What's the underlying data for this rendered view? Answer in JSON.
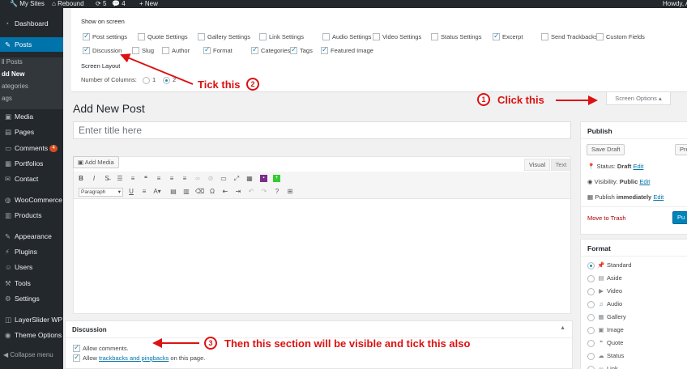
{
  "adminbar": {
    "my_sites": "My Sites",
    "site": "Rebound",
    "updates": "5",
    "comments": "4",
    "new": "New",
    "howdy": "Howdy, A"
  },
  "sidebar": {
    "dashboard": "Dashboard",
    "posts": "Posts",
    "sub": [
      "ll Posts",
      "dd New",
      "ategories",
      "ags"
    ],
    "media": "Media",
    "pages": "Pages",
    "comments": "Comments",
    "comments_badge": "4",
    "portfolios": "Portfolios",
    "contact": "Contact",
    "woocommerce": "WooCommerce",
    "products": "Products",
    "appearance": "Appearance",
    "plugins": "Plugins",
    "users": "Users",
    "tools": "Tools",
    "settings": "Settings",
    "layerslider": "LayerSlider WP",
    "theme_options": "Theme Options",
    "collapse": "Collapse menu"
  },
  "screen_options": {
    "show_on_screen": "Show on screen",
    "boxes": [
      {
        "label": "Post settings",
        "checked": true
      },
      {
        "label": "Quote Settings",
        "checked": false
      },
      {
        "label": "Gallery Settings",
        "checked": false
      },
      {
        "label": "Link Settings",
        "checked": false
      },
      {
        "label": "Audio Settings",
        "checked": false
      },
      {
        "label": "Video Settings",
        "checked": false
      },
      {
        "label": "Status Settings",
        "checked": false
      },
      {
        "label": "Excerpt",
        "checked": true
      },
      {
        "label": "Send Trackbacks",
        "checked": false
      },
      {
        "label": "Custom Fields",
        "checked": false
      },
      {
        "label": "Discussion",
        "checked": true
      },
      {
        "label": "Slug",
        "checked": false
      },
      {
        "label": "Author",
        "checked": false
      },
      {
        "label": "Format",
        "checked": true
      },
      {
        "label": "Categories",
        "checked": true
      },
      {
        "label": "Tags",
        "checked": true
      },
      {
        "label": "Featured Image",
        "checked": true
      }
    ],
    "screen_layout": "Screen Layout",
    "columns_label": "Number of Columns:",
    "col1": "1",
    "col2": "2",
    "selected_columns": "2",
    "tab_label": "Screen Options"
  },
  "annotations": {
    "a1_num": "1",
    "a1_text": "Click this",
    "a2_num": "2",
    "a2_text": "Tick this",
    "a3_num": "3",
    "a3_text": "Then this section will be visible and tick this also",
    "color": "#dd1111"
  },
  "editor": {
    "page_title": "Add New Post",
    "title_placeholder": "Enter title here",
    "add_media": "Add Media",
    "tab_visual": "Visual",
    "tab_text": "Text",
    "paragraph_select": "Paragraph"
  },
  "discussion": {
    "title": "Discussion",
    "allow_comments": "Allow comments.",
    "allow_prefix": "Allow ",
    "allow_link": "trackbacks and pingbacks",
    "allow_suffix": " on this page."
  },
  "publish": {
    "title": "Publish",
    "save_draft": "Save Draft",
    "preview": "Pre",
    "status_label": "Status: ",
    "status_value": "Draft",
    "visibility_label": "Visibility: ",
    "visibility_value": "Public",
    "publish_label": "Publish ",
    "publish_value": "immediately",
    "edit": "Edit",
    "move_to_trash": "Move to Trash",
    "publish_btn": "Pu"
  },
  "format": {
    "title": "Format",
    "options": [
      "Standard",
      "Aside",
      "Video",
      "Audio",
      "Gallery",
      "Image",
      "Quote",
      "Status",
      "Link"
    ],
    "selected": "Standard"
  },
  "colors": {
    "accent": "#0073aa",
    "admin_dark": "#23282d",
    "annotation": "#dd1111"
  }
}
